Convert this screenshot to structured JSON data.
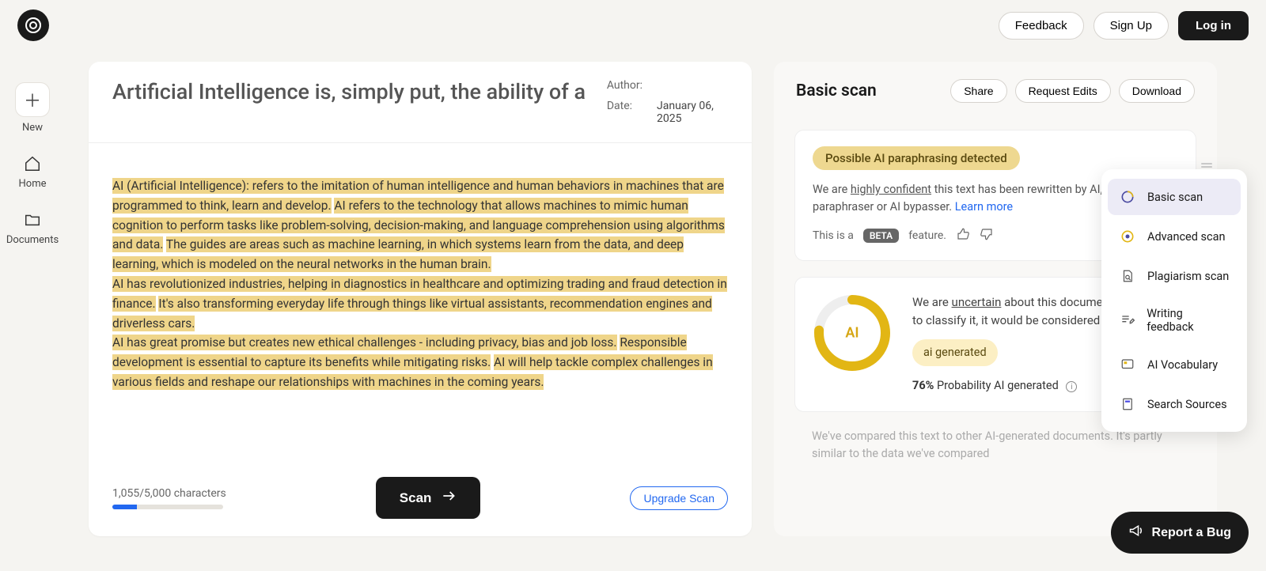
{
  "header": {
    "feedback": "Feedback",
    "signup": "Sign Up",
    "login": "Log in"
  },
  "sidebar": {
    "new": "New",
    "home": "Home",
    "documents": "Documents"
  },
  "editor": {
    "title": "Artificial Intelligence is, simply put, the ability of a",
    "author_label": "Author:",
    "author_value": "",
    "date_label": "Date:",
    "date_value": "January 06, 2025",
    "body": {
      "s1": "AI (Artificial Intelligence): refers to the imitation of human intelligence and human behaviors in machines that are programmed to think, learn and develop.",
      "s2": "AI refers to the technology that allows machines to mimic human cognition to perform tasks like problem-solving, decision-making, and language comprehension using algorithms and data.",
      "s3": "The guides are areas such as machine learning, in which systems learn from the data, and deep learning, which is modeled on the neural networks in the human brain.",
      "s4": "AI has revolutionized industries, helping in diagnostics in healthcare and optimizing trading and fraud detection in finance.",
      "s5": "It's also transforming everyday life through things like virtual assistants, recommendation engines and driverless cars.",
      "s6": "AI has great promise but creates new ethical challenges - including privacy, bias and job loss.",
      "s7": "Responsible development is essential to capture its benefits while mitigating risks.",
      "s8": "AI will help tackle complex challenges in various fields and reshape our relationships with machines in the coming years."
    },
    "char_count": "1,055/5,000 characters",
    "scan": "Scan",
    "upgrade": "Upgrade Scan"
  },
  "right": {
    "title": "Basic scan",
    "share": "Share",
    "request_edits": "Request Edits",
    "download": "Download",
    "paraphrase": {
      "pill": "Possible AI paraphrasing detected",
      "pre": "We are ",
      "conf": "highly confident",
      "post": " this text has been rewritten by AI, an AI paraphraser or AI bypasser. ",
      "learn_more": "Learn more",
      "this_is_a": "This is a ",
      "beta": "BETA",
      "feature": " feature."
    },
    "gauge": {
      "label": "AI",
      "pre": "We are ",
      "word": "uncertain",
      "post": " about this document. If we had to classify it, it would be considered",
      "verdict": "ai generated",
      "pct": "76%",
      "prob_text": " Probability AI generated"
    },
    "compared": "We've compared this text to other AI-generated documents. It's partly similar to the data we've compared"
  },
  "menu": {
    "basic": "Basic scan",
    "advanced": "Advanced scan",
    "plagiarism": "Plagiarism scan",
    "writing": "Writing feedback",
    "vocab": "AI Vocabulary",
    "sources": "Search Sources"
  },
  "bug": "Report a Bug"
}
